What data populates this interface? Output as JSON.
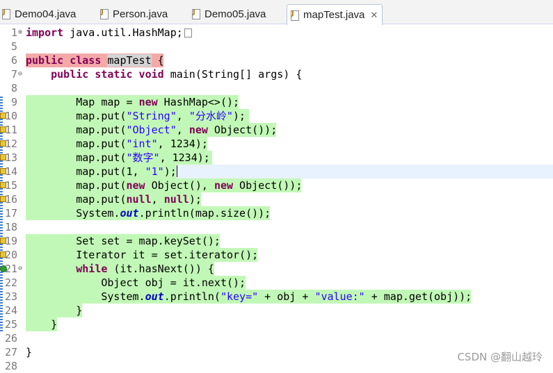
{
  "tabs": [
    {
      "label": "Demo04.java",
      "active": false
    },
    {
      "label": "Person.java",
      "active": false
    },
    {
      "label": "Demo05.java",
      "active": false
    },
    {
      "label": "mapTest.java",
      "active": true,
      "close": "✕"
    }
  ],
  "line_numbers": [
    "1",
    "5",
    "6",
    "7",
    "8",
    "9",
    "10",
    "11",
    "12",
    "13",
    "14",
    "15",
    "16",
    "17",
    "18",
    "19",
    "20",
    "21",
    "22",
    "23",
    "24",
    "25",
    "26",
    "27",
    "28"
  ],
  "code": {
    "l1_kw": "import",
    "l1_rest": " java.util.HashMap;",
    "l6_kw1": "public",
    "l6_kw2": "class",
    "l6_name": "mapTest",
    "l6_rest": " {",
    "l7_indent": "    ",
    "l7_kw": "public static void",
    "l7_rest": " main(String[] args) {",
    "l9_a": "        Map map = ",
    "l9_kw": "new",
    "l9_b": " HashMap<>();",
    "l10_a": "        map.put(",
    "l10_s1": "\"String\"",
    "l10_b": ", ",
    "l10_s2": "\"分水岭\"",
    "l10_c": ");",
    "l11_a": "        map.put(",
    "l11_s": "\"Object\"",
    "l11_b": ", ",
    "l11_kw": "new",
    "l11_c": " Object());",
    "l12_a": "        map.put(",
    "l12_s": "\"int\"",
    "l12_b": ", 1234);",
    "l13_a": "        map.put(",
    "l13_s": "\"数字\"",
    "l13_b": ", 1234);",
    "l14_a": "        map.put(1, ",
    "l14_s": "\"1\"",
    "l14_b": ");",
    "l15_a": "        map.put(",
    "l15_kw1": "new",
    "l15_b": " Object(), ",
    "l15_kw2": "new",
    "l15_c": " Object());",
    "l16_a": "        map.put(",
    "l16_kw1": "null",
    "l16_b": ", ",
    "l16_kw2": "null",
    "l16_c": ");",
    "l17_a": "        System.",
    "l17_f": "out",
    "l17_b": ".println(map.size());",
    "l19": "        Set set = map.keySet();",
    "l20": "        Iterator it = set.iterator();",
    "l21_a": "        ",
    "l21_kw": "while",
    "l21_b": " (it.hasNext()) {",
    "l22": "            Object obj = it.next();",
    "l23_a": "            System.",
    "l23_f": "out",
    "l23_b": ".println(",
    "l23_s1": "\"key=\"",
    "l23_c": " + obj + ",
    "l23_s2": "\"value:\"",
    "l23_d": " + map.get(obj));",
    "l24": "        }",
    "l25": "    }",
    "l27": "}"
  },
  "watermark": "CSDN @翻山越玲",
  "colors": {
    "keyword": "#7f0055",
    "string": "#2a00ff",
    "static_field": "#0000c0",
    "added_line": "#c2f8b7",
    "changed_line": "#f4a9a9"
  }
}
